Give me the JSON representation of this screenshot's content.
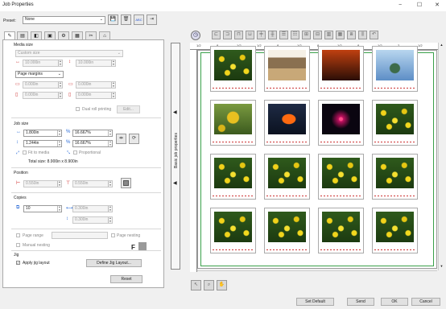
{
  "window": {
    "title": "Job Properties",
    "min": "−",
    "max": "☐",
    "close": "✕"
  },
  "preset": {
    "label": "Preset:",
    "value": "None"
  },
  "tabs": [
    "tab-general",
    "tab-layout",
    "tab-color",
    "tab-output",
    "tab-options",
    "tab-marks",
    "tab-cut",
    "tab-print"
  ],
  "media": {
    "heading": "Media size",
    "size_select": "Custom size",
    "width": "10.000in",
    "height": "10.000in",
    "margins_select": "Page margins",
    "margin_top": "0.000in",
    "margin_bottom": "0.000in",
    "margin_left": "0.000in",
    "margin_right": "0.000in",
    "dual_roll": "Dual roll printing",
    "edit": "Edit..."
  },
  "jobsize": {
    "heading": "Job size",
    "width": "1.800in",
    "height": "1.244in",
    "scale_w": "16.667%",
    "scale_h": "16.667%",
    "fit_media": "Fit to media",
    "proportional": "Proportional",
    "total": "Total size:   8.900in x 8.900in"
  },
  "position": {
    "heading": "Position",
    "x": "0.550in",
    "y": "0.550in"
  },
  "copies": {
    "heading": "Copies",
    "count": "10",
    "spacing_h": "0.300in",
    "spacing_v": "0.300in"
  },
  "ranges": {
    "page_range": "Page range",
    "page_nesting": "Page nesting",
    "manual_nesting": "Manual nesting"
  },
  "jig": {
    "heading": "Jig",
    "apply": "Apply jig layout",
    "define": "Define Jig Layout...",
    "f_label": "F"
  },
  "reset": "Reset",
  "side_tab": "Basic job properties",
  "ruler_top": [
    "1/2",
    "8",
    "1/2",
    "1/2",
    "8",
    "1/2",
    "8",
    "1/2",
    "8",
    "1/2",
    "2",
    "1/2"
  ],
  "footer": {
    "set_default": "Set Default",
    "send": "Send",
    "ok": "OK",
    "cancel": "Cancel"
  },
  "photos": [
    [
      "flowers",
      "stones",
      "sunset",
      "liberty"
    ],
    [
      "dandy",
      "orange",
      "firew",
      "flowers"
    ],
    [
      "flowers",
      "flowers",
      "flowers",
      "flowers"
    ],
    [
      "flowers",
      "flowers",
      "flowers",
      "flowers"
    ]
  ]
}
